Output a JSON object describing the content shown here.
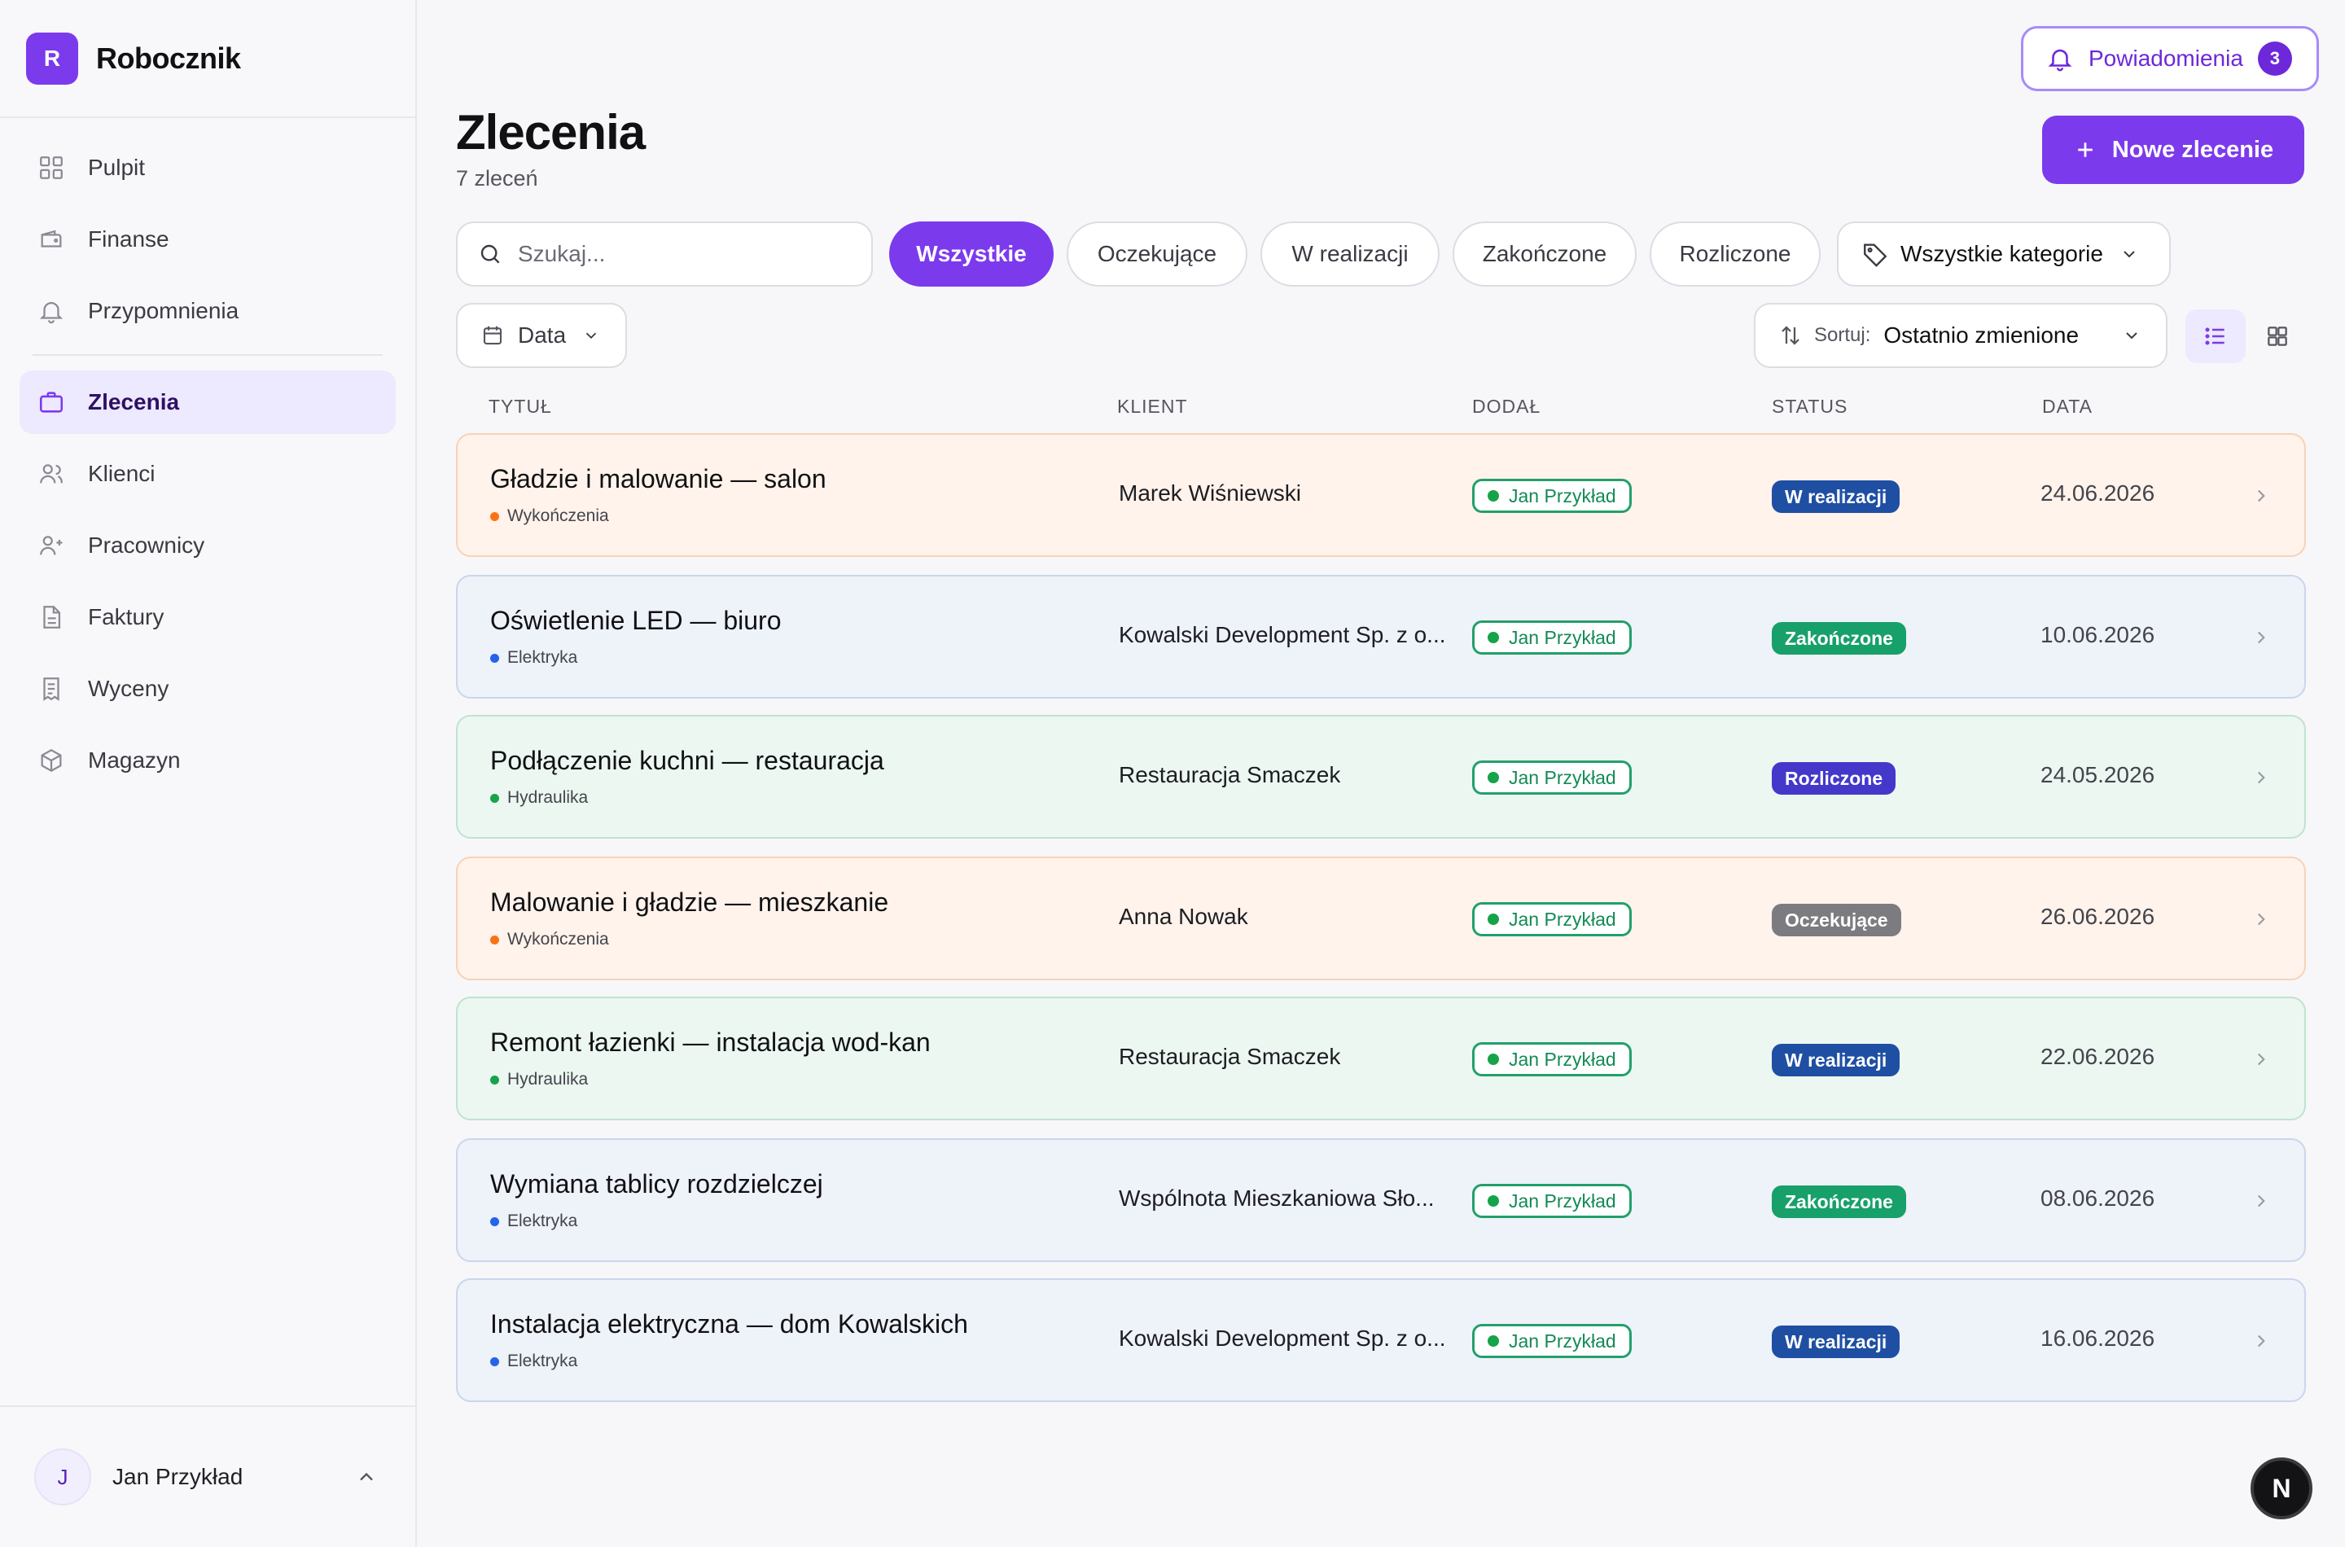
{
  "brand": {
    "logo_letter": "R",
    "name": "Robocznik"
  },
  "sidebar": {
    "items": [
      {
        "label": "Pulpit",
        "icon": "grid-icon"
      },
      {
        "label": "Finanse",
        "icon": "wallet-icon"
      },
      {
        "label": "Przypomnienia",
        "icon": "bell-icon"
      },
      {
        "label": "Zlecenia",
        "icon": "briefcase-icon",
        "active": true
      },
      {
        "label": "Klienci",
        "icon": "users-icon"
      },
      {
        "label": "Pracownicy",
        "icon": "user-plus-icon"
      },
      {
        "label": "Faktury",
        "icon": "file-icon"
      },
      {
        "label": "Wyceny",
        "icon": "receipt-icon"
      },
      {
        "label": "Magazyn",
        "icon": "box-icon"
      }
    ]
  },
  "user": {
    "initial": "J",
    "name": "Jan Przykład"
  },
  "notifications": {
    "label": "Powiadomienia",
    "count": "3"
  },
  "new_order": {
    "label": "Nowe zlecenie"
  },
  "page": {
    "title": "Zlecenia",
    "count": "7 zleceń"
  },
  "search": {
    "placeholder": "Szukaj..."
  },
  "filters": {
    "pills": [
      "Wszystkie",
      "Oczekujące",
      "W realizacji",
      "Zakończone",
      "Rozliczone"
    ],
    "active_index": 0,
    "category": "Wszystkie kategorie",
    "date": "Data"
  },
  "sort": {
    "label": "Sortuj:",
    "value": "Ostatnio zmienione"
  },
  "table": {
    "headers": {
      "title": "TYTUŁ",
      "client": "KLIENT",
      "added_by": "DODAŁ",
      "status": "STATUS",
      "date": "DATA"
    },
    "rows": [
      {
        "title": "Gładzie i malowanie — salon",
        "category": "Wykończenia",
        "client": "Marek Wiśniewski",
        "added_by": "Jan Przykład",
        "status": "W realizacji",
        "date": "24.06.2026"
      },
      {
        "title": "Oświetlenie LED — biuro",
        "category": "Elektryka",
        "client": "Kowalski Development Sp. z o...",
        "added_by": "Jan Przykład",
        "status": "Zakończone",
        "date": "10.06.2026"
      },
      {
        "title": "Podłączenie kuchni — restauracja",
        "category": "Hydraulika",
        "client": "Restauracja Smaczek",
        "added_by": "Jan Przykład",
        "status": "Rozliczone",
        "date": "24.05.2026"
      },
      {
        "title": "Malowanie i gładzie — mieszkanie",
        "category": "Wykończenia",
        "client": "Anna Nowak",
        "added_by": "Jan Przykład",
        "status": "Oczekujące",
        "date": "26.06.2026"
      },
      {
        "title": "Remont łazienki — instalacja wod-kan",
        "category": "Hydraulika",
        "client": "Restauracja Smaczek",
        "added_by": "Jan Przykład",
        "status": "W realizacji",
        "date": "22.06.2026"
      },
      {
        "title": "Wymiana tablicy rozdzielczej",
        "category": "Elektryka",
        "client": "Wspólnota Mieszkaniowa Sło...",
        "added_by": "Jan Przykład",
        "status": "Zakończone",
        "date": "08.06.2026"
      },
      {
        "title": "Instalacja elektryczna — dom Kowalskich",
        "category": "Elektryka",
        "client": "Kowalski Development Sp. z o...",
        "added_by": "Jan Przykład",
        "status": "W realizacji",
        "date": "16.06.2026"
      }
    ]
  },
  "colors": {
    "accent": "#7c3aed",
    "status_w_realizacji": "#1e4fa3",
    "status_zakonczone": "#17a06a",
    "status_rozliczone": "#4338ca",
    "status_oczekujace": "#7b7b80",
    "category_wykonczenia": "#f97316",
    "category_elektryka": "#2563eb",
    "category_hydraulika": "#16a34a"
  },
  "corner_badge": "N"
}
